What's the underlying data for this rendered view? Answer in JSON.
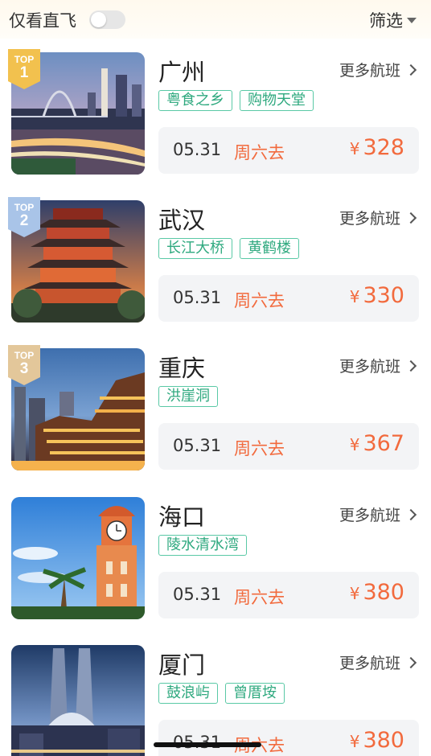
{
  "header": {
    "direct_flight_label": "仅看直飞",
    "direct_flight_on": false,
    "filter_label": "筛选"
  },
  "more_label": "更多航班",
  "currency_symbol": "¥",
  "destinations": [
    {
      "rank_label": "TOP",
      "rank": "1",
      "badge_color": "#f2c14e",
      "city": "广州",
      "tags": [
        "粤食之乡",
        "购物天堂"
      ],
      "date": "05.31",
      "weekday": "周六去",
      "price": "328",
      "image": "guangzhou-tower-night-photo"
    },
    {
      "rank_label": "TOP",
      "rank": "2",
      "badge_color": "#a9c4e8",
      "city": "武汉",
      "tags": [
        "长江大桥",
        "黄鹤楼"
      ],
      "date": "05.31",
      "weekday": "周六去",
      "price": "330",
      "image": "yellow-crane-tower-photo"
    },
    {
      "rank_label": "TOP",
      "rank": "3",
      "badge_color": "#e3c79a",
      "city": "重庆",
      "tags": [
        "洪崖洞"
      ],
      "date": "05.31",
      "weekday": "周六去",
      "price": "367",
      "image": "hongya-cave-night-photo"
    },
    {
      "city": "海口",
      "tags": [
        "陵水清水湾"
      ],
      "date": "05.31",
      "weekday": "周六去",
      "price": "380",
      "image": "haikou-clock-tower-photo"
    },
    {
      "city": "厦门",
      "tags": [
        "鼓浪屿",
        "曾厝垵"
      ],
      "date": "05.31",
      "weekday": "周六去",
      "price": "380",
      "image": "xiamen-twin-towers-photo"
    }
  ],
  "colors": {
    "accent_orange": "#f26a3d",
    "tag_green": "#2fa97f",
    "tag_border": "#5ac9a6",
    "fare_bg": "#f3f4f6"
  }
}
